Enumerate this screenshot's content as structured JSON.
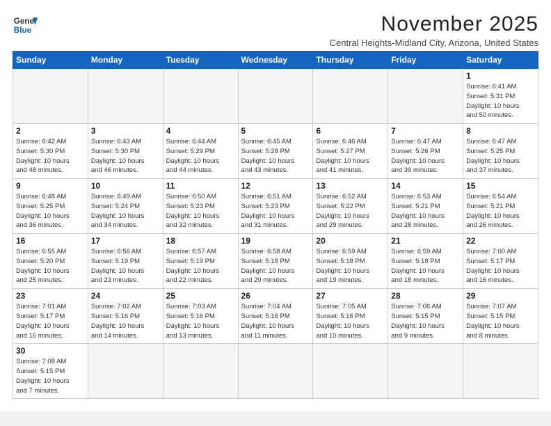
{
  "header": {
    "logo_line1": "General",
    "logo_line2": "Blue",
    "month": "November 2025",
    "location": "Central Heights-Midland City, Arizona, United States"
  },
  "weekdays": [
    "Sunday",
    "Monday",
    "Tuesday",
    "Wednesday",
    "Thursday",
    "Friday",
    "Saturday"
  ],
  "weeks": [
    [
      {
        "day": "",
        "info": ""
      },
      {
        "day": "",
        "info": ""
      },
      {
        "day": "",
        "info": ""
      },
      {
        "day": "",
        "info": ""
      },
      {
        "day": "",
        "info": ""
      },
      {
        "day": "",
        "info": ""
      },
      {
        "day": "1",
        "info": "Sunrise: 6:41 AM\nSunset: 5:31 PM\nDaylight: 10 hours\nand 50 minutes."
      }
    ],
    [
      {
        "day": "2",
        "info": "Sunrise: 6:42 AM\nSunset: 5:30 PM\nDaylight: 10 hours\nand 48 minutes."
      },
      {
        "day": "3",
        "info": "Sunrise: 6:43 AM\nSunset: 5:30 PM\nDaylight: 10 hours\nand 46 minutes."
      },
      {
        "day": "4",
        "info": "Sunrise: 6:44 AM\nSunset: 5:29 PM\nDaylight: 10 hours\nand 44 minutes."
      },
      {
        "day": "5",
        "info": "Sunrise: 6:45 AM\nSunset: 5:28 PM\nDaylight: 10 hours\nand 43 minutes."
      },
      {
        "day": "6",
        "info": "Sunrise: 6:46 AM\nSunset: 5:27 PM\nDaylight: 10 hours\nand 41 minutes."
      },
      {
        "day": "7",
        "info": "Sunrise: 6:47 AM\nSunset: 5:26 PM\nDaylight: 10 hours\nand 39 minutes."
      },
      {
        "day": "8",
        "info": "Sunrise: 6:47 AM\nSunset: 5:25 PM\nDaylight: 10 hours\nand 37 minutes."
      }
    ],
    [
      {
        "day": "9",
        "info": "Sunrise: 6:48 AM\nSunset: 5:25 PM\nDaylight: 10 hours\nand 36 minutes."
      },
      {
        "day": "10",
        "info": "Sunrise: 6:49 AM\nSunset: 5:24 PM\nDaylight: 10 hours\nand 34 minutes."
      },
      {
        "day": "11",
        "info": "Sunrise: 6:50 AM\nSunset: 5:23 PM\nDaylight: 10 hours\nand 32 minutes."
      },
      {
        "day": "12",
        "info": "Sunrise: 6:51 AM\nSunset: 5:23 PM\nDaylight: 10 hours\nand 31 minutes."
      },
      {
        "day": "13",
        "info": "Sunrise: 6:52 AM\nSunset: 5:22 PM\nDaylight: 10 hours\nand 29 minutes."
      },
      {
        "day": "14",
        "info": "Sunrise: 6:53 AM\nSunset: 5:21 PM\nDaylight: 10 hours\nand 28 minutes."
      },
      {
        "day": "15",
        "info": "Sunrise: 6:54 AM\nSunset: 5:21 PM\nDaylight: 10 hours\nand 26 minutes."
      }
    ],
    [
      {
        "day": "16",
        "info": "Sunrise: 6:55 AM\nSunset: 5:20 PM\nDaylight: 10 hours\nand 25 minutes."
      },
      {
        "day": "17",
        "info": "Sunrise: 6:56 AM\nSunset: 5:19 PM\nDaylight: 10 hours\nand 23 minutes."
      },
      {
        "day": "18",
        "info": "Sunrise: 6:57 AM\nSunset: 5:19 PM\nDaylight: 10 hours\nand 22 minutes."
      },
      {
        "day": "19",
        "info": "Sunrise: 6:58 AM\nSunset: 5:18 PM\nDaylight: 10 hours\nand 20 minutes."
      },
      {
        "day": "20",
        "info": "Sunrise: 6:59 AM\nSunset: 5:18 PM\nDaylight: 10 hours\nand 19 minutes."
      },
      {
        "day": "21",
        "info": "Sunrise: 6:59 AM\nSunset: 5:18 PM\nDaylight: 10 hours\nand 18 minutes."
      },
      {
        "day": "22",
        "info": "Sunrise: 7:00 AM\nSunset: 5:17 PM\nDaylight: 10 hours\nand 16 minutes."
      }
    ],
    [
      {
        "day": "23",
        "info": "Sunrise: 7:01 AM\nSunset: 5:17 PM\nDaylight: 10 hours\nand 15 minutes."
      },
      {
        "day": "24",
        "info": "Sunrise: 7:02 AM\nSunset: 5:16 PM\nDaylight: 10 hours\nand 14 minutes."
      },
      {
        "day": "25",
        "info": "Sunrise: 7:03 AM\nSunset: 5:16 PM\nDaylight: 10 hours\nand 13 minutes."
      },
      {
        "day": "26",
        "info": "Sunrise: 7:04 AM\nSunset: 5:16 PM\nDaylight: 10 hours\nand 11 minutes."
      },
      {
        "day": "27",
        "info": "Sunrise: 7:05 AM\nSunset: 5:16 PM\nDaylight: 10 hours\nand 10 minutes."
      },
      {
        "day": "28",
        "info": "Sunrise: 7:06 AM\nSunset: 5:15 PM\nDaylight: 10 hours\nand 9 minutes."
      },
      {
        "day": "29",
        "info": "Sunrise: 7:07 AM\nSunset: 5:15 PM\nDaylight: 10 hours\nand 8 minutes."
      }
    ],
    [
      {
        "day": "30",
        "info": "Sunrise: 7:08 AM\nSunset: 5:15 PM\nDaylight: 10 hours\nand 7 minutes."
      },
      {
        "day": "",
        "info": ""
      },
      {
        "day": "",
        "info": ""
      },
      {
        "day": "",
        "info": ""
      },
      {
        "day": "",
        "info": ""
      },
      {
        "day": "",
        "info": ""
      },
      {
        "day": "",
        "info": ""
      }
    ]
  ]
}
